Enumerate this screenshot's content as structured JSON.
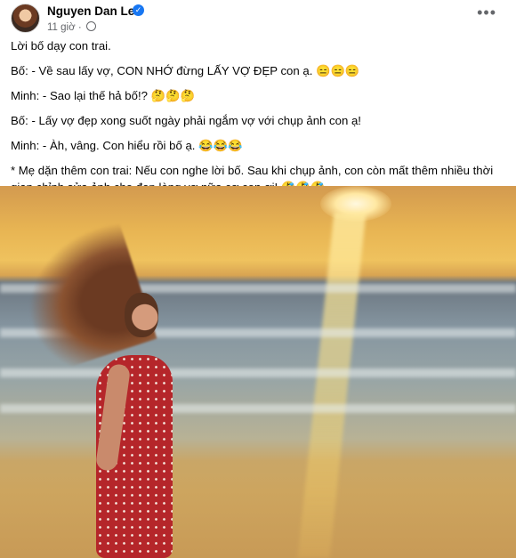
{
  "post": {
    "author": "Nguyen Dan Le",
    "time": "11 giờ ·",
    "more": "•••",
    "paragraphs": [
      "Lời bố dạy con trai.",
      "Bố: - Về sau lấy vợ, CON NHỚ đừng LẤY VỢ ĐẸP con ạ. 😑😑😑",
      "Minh: - Sao lại thế hả bố!? 🤔🤔🤔",
      "Bố: - Lấy vợ đẹp xong suốt ngày phải ngắm vợ với chụp ảnh con ạ!",
      "Minh: - Àh, vâng. Con hiểu rồi bố ạ. 😂😂😂",
      "* Mẹ dặn thêm con trai: Nếu con nghe lời bố. Sau khi chụp ảnh, con còn mất thêm nhiều thời gian chỉnh sửa ảnh cho đẹp lòng vợ nữa cơ con ơi! 🤣🤣🤣"
    ]
  },
  "icons": {
    "verified": "verified-badge-icon",
    "privacy": "globe-icon",
    "menu": "more-options-icon"
  },
  "colors": {
    "verified": "#1877f2",
    "secondary_text": "#65676b",
    "sunset": "#efc25e",
    "dress": "#b5262a"
  }
}
